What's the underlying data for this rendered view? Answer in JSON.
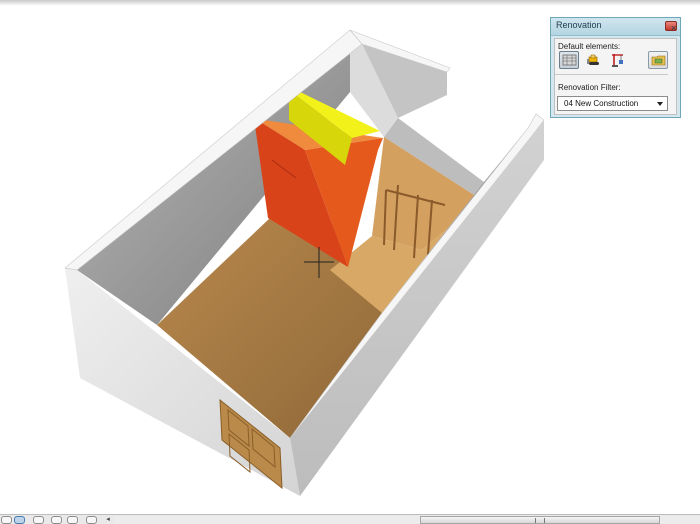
{
  "palette": {
    "title": "Renovation",
    "close_glyph": "×",
    "default_elements_label": "Default elements:",
    "tools": [
      {
        "icon": "existing-elements-icon",
        "pressed": true
      },
      {
        "icon": "demolition-bulldozer-icon",
        "pressed": false
      },
      {
        "icon": "new-construction-crane-icon",
        "pressed": false
      },
      {
        "icon": "settings-folder-icon",
        "pressed": false
      }
    ],
    "filter_label": "Renovation Filter:",
    "filter_value": "04 New Construction"
  },
  "statusbar": {
    "scroll_left_glyph": "◂"
  },
  "colors": {
    "wall_top": "#f4f4f4",
    "wall_interior": "#9a9a9a",
    "floor": "#a87c45",
    "demolition": "#de4a12",
    "new_element": "#e3e50c",
    "palette_bg": "#d4e6ee"
  }
}
